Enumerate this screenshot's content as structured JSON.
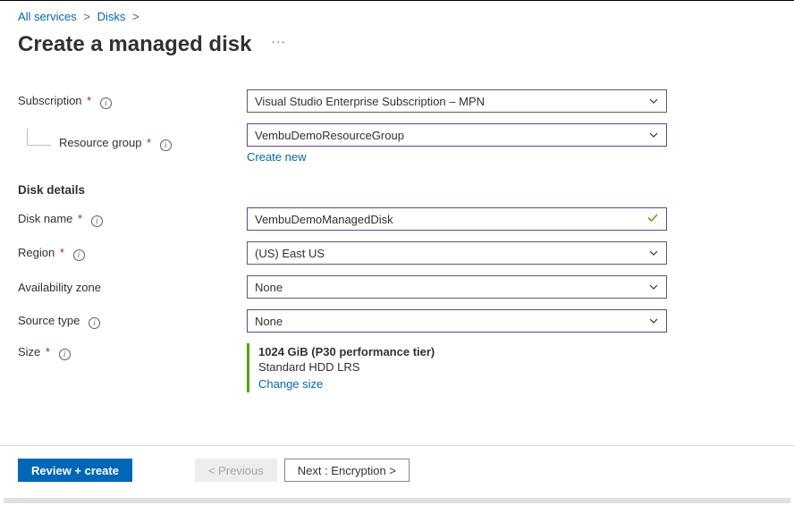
{
  "breadcrumb": {
    "item1": "All services",
    "item2": "Disks"
  },
  "page_title": "Create a managed disk",
  "labels": {
    "subscription": "Subscription",
    "resource_group": "Resource group",
    "disk_name": "Disk name",
    "region": "Region",
    "availability_zone": "Availability zone",
    "source_type": "Source type",
    "size": "Size"
  },
  "values": {
    "subscription": "Visual Studio Enterprise Subscription – MPN",
    "resource_group": "VembuDemoResourceGroup",
    "disk_name": "VembuDemoManagedDisk",
    "region": "(US) East US",
    "availability_zone": "None",
    "source_type": "None"
  },
  "links": {
    "create_new": "Create new",
    "change_size": "Change size"
  },
  "sections": {
    "disk_details": "Disk details"
  },
  "size_info": {
    "line1": "1024 GiB (P30 performance tier)",
    "line2": "Standard HDD LRS"
  },
  "footer": {
    "review": "Review + create",
    "previous": "< Previous",
    "next": "Next : Encryption >"
  }
}
